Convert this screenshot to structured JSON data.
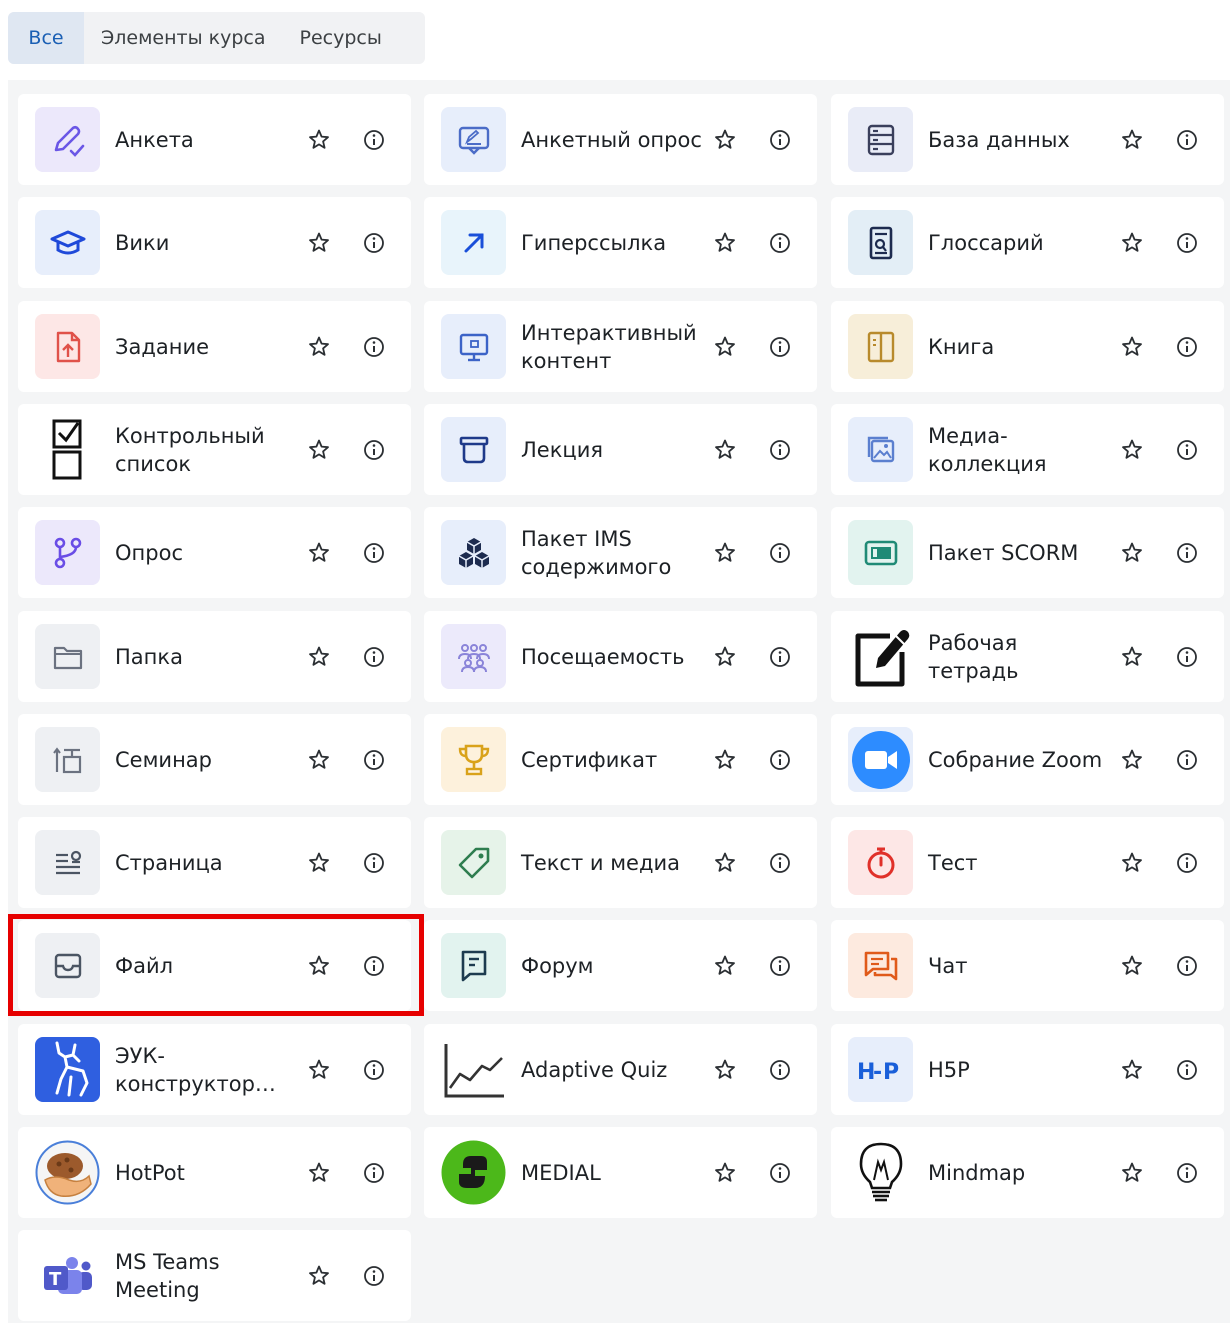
{
  "tabs": [
    {
      "label": "Все",
      "active": true
    },
    {
      "label": "Элементы курса",
      "active": false
    },
    {
      "label": "Ресурсы",
      "active": false
    }
  ],
  "modules": [
    {
      "label": "Анкета",
      "icon": "pencil-check-icon",
      "bg": "#ece8fb",
      "color": "#6a56e6"
    },
    {
      "label": "Анкетный опрос",
      "icon": "survey-chat-icon",
      "bg": "#e7eefb",
      "color": "#4b6cc7"
    },
    {
      "label": "База данных",
      "icon": "database-icon",
      "bg": "#e9ecf7",
      "color": "#3a3f5c"
    },
    {
      "label": "Вики",
      "icon": "graduation-cap-icon",
      "bg": "#e7eefb",
      "color": "#1f49d9"
    },
    {
      "label": "Гиперссылка",
      "icon": "arrow-up-right-icon",
      "bg": "#e8f4fb",
      "color": "#1a4fd9"
    },
    {
      "label": "Глоссарий",
      "icon": "glossary-icon",
      "bg": "#e3eef6",
      "color": "#1d2b4f"
    },
    {
      "label": "Задание",
      "icon": "assignment-upload-icon",
      "bg": "#fde7e6",
      "color": "#e0524a"
    },
    {
      "label": "Интерактивный контент",
      "icon": "monitor-icon",
      "bg": "#e7eefb",
      "color": "#3c63c7"
    },
    {
      "label": "Книга",
      "icon": "book-icon",
      "bg": "#f7eed9",
      "color": "#b88a2c"
    },
    {
      "label": "Контрольный список",
      "icon": "checklist-icon",
      "bg": "#ffffff",
      "color": "#111111"
    },
    {
      "label": "Лекция",
      "icon": "lecture-icon",
      "bg": "#e7eefb",
      "color": "#1f3a8a"
    },
    {
      "label": "Медиа-коллекция",
      "icon": "media-collection-icon",
      "bg": "#e7eefb",
      "color": "#5b7fcf"
    },
    {
      "label": "Опрос",
      "icon": "choice-branch-icon",
      "bg": "#ece8fb",
      "color": "#6a4de6"
    },
    {
      "label": "Пакет IMS содержимого",
      "icon": "cubes-icon",
      "bg": "#e7eefb",
      "color": "#1d2b4f"
    },
    {
      "label": "Пакет SCORM",
      "icon": "scorm-package-icon",
      "bg": "#e2f3ef",
      "color": "#1f8a76"
    },
    {
      "label": "Папка",
      "icon": "folder-icon",
      "bg": "#eef0f3",
      "color": "#6b7280"
    },
    {
      "label": "Посещаемость",
      "icon": "people-group-icon",
      "bg": "#eceafb",
      "color": "#8a84d9"
    },
    {
      "label": "Рабочая тетрадь",
      "icon": "edit-square-icon",
      "bg": "#ffffff",
      "color": "#111111"
    },
    {
      "label": "Семинар",
      "icon": "workshop-icon",
      "bg": "#eef0f3",
      "color": "#6b7280"
    },
    {
      "label": "Сертификат",
      "icon": "trophy-icon",
      "bg": "#fdf1dc",
      "color": "#d9a21a"
    },
    {
      "label": "Собрание Zoom",
      "icon": "zoom-camera-icon",
      "bg": "#e7eefb",
      "color": "#2d8cff"
    },
    {
      "label": "Страница",
      "icon": "page-lines-icon",
      "bg": "#eef0f3",
      "color": "#4b5563"
    },
    {
      "label": "Текст и медиа",
      "icon": "tag-icon",
      "bg": "#e6f3e9",
      "color": "#2e7d4f"
    },
    {
      "label": "Тест",
      "icon": "stopwatch-icon",
      "bg": "#fde7e6",
      "color": "#e0312a"
    },
    {
      "label": "Файл",
      "icon": "file-inbox-icon",
      "bg": "#eef0f3",
      "color": "#4b5563"
    },
    {
      "label": "Форум",
      "icon": "forum-chat-icon",
      "bg": "#e2f3ef",
      "color": "#1d3b4f"
    },
    {
      "label": "Чат",
      "icon": "chat-bubbles-icon",
      "bg": "#fdeadf",
      "color": "#e05a1a"
    },
    {
      "label": "ЭУК-конструктор…",
      "icon": "deer-logo-icon",
      "bg": "#2f5fe0",
      "color": "#ffffff"
    },
    {
      "label": "Adaptive Quiz",
      "icon": "line-chart-icon",
      "bg": "#ffffff",
      "color": "#333333"
    },
    {
      "label": "H5P",
      "icon": "h5p-logo-icon",
      "bg": "#e7eefb",
      "color": "#1a5fd9"
    },
    {
      "label": "HotPot",
      "icon": "hotpot-hand-icon",
      "bg": "#ffffff",
      "color": "#8b5a2b"
    },
    {
      "label": "MEDIAL",
      "icon": "medial-logo-icon",
      "bg": "#ffffff",
      "color": "#4cb81a"
    },
    {
      "label": "Mindmap",
      "icon": "lightbulb-icon",
      "bg": "#ffffff",
      "color": "#111111"
    },
    {
      "label": "MS Teams Meeting",
      "icon": "teams-logo-icon",
      "bg": "#ffffff",
      "color": "#5059c9"
    }
  ],
  "highlighted_index": 24
}
